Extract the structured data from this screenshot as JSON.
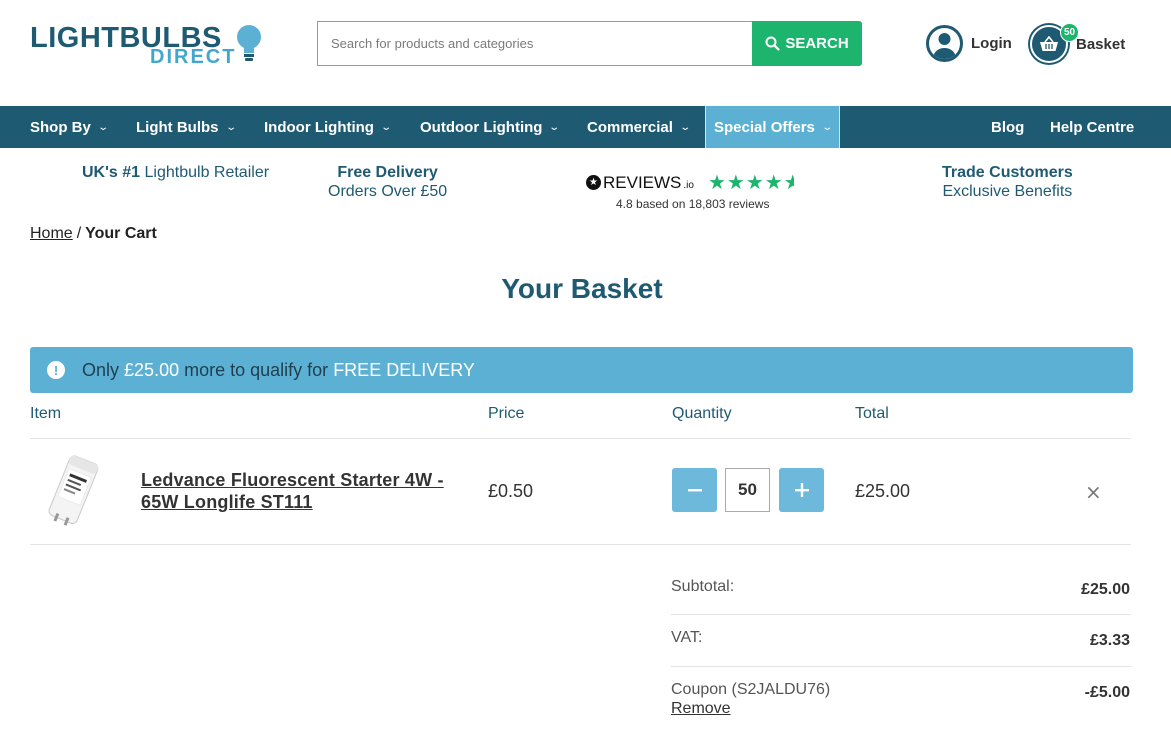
{
  "header": {
    "logo_top": "LIGHTBULBS",
    "logo_bottom": "DIRECT",
    "search_placeholder": "Search for products and categories",
    "search_button": "SEARCH",
    "login_label": "Login",
    "basket_label": "Basket",
    "basket_count": "50"
  },
  "nav": {
    "items": [
      {
        "label": "Shop By"
      },
      {
        "label": "Light Bulbs"
      },
      {
        "label": "Indoor Lighting"
      },
      {
        "label": "Outdoor Lighting"
      },
      {
        "label": "Commercial"
      },
      {
        "label": "Special Offers"
      }
    ],
    "blog": "Blog",
    "help": "Help Centre"
  },
  "usp": {
    "retailer_bold": "UK's #1",
    "retailer_rest": "Lightbulb Retailer",
    "delivery_line1": "Free Delivery",
    "delivery_line2": "Orders Over £50",
    "reviews_brand": "REVIEWS",
    "reviews_suffix": ".io",
    "reviews_rating": 4.8,
    "reviews_text": "4.8 based on 18,803 reviews",
    "trade_line1": "Trade Customers",
    "trade_line2": "Exclusive Benefits"
  },
  "breadcrumb": {
    "home": "Home",
    "separator": "/",
    "current": "Your Cart"
  },
  "page_title": "Your Basket",
  "banner": {
    "prefix": "Only",
    "amount": "£25.00",
    "middle": "more to qualify for",
    "highlight": "FREE DELIVERY"
  },
  "table": {
    "headers": {
      "item": "Item",
      "price": "Price",
      "quantity": "Quantity",
      "total": "Total"
    },
    "rows": [
      {
        "name": "Ledvance Fluorescent Starter 4W - 65W Longlife ST111",
        "price": "£0.50",
        "quantity": "50",
        "total": "£25.00"
      }
    ]
  },
  "summary": {
    "subtotal_label": "Subtotal:",
    "subtotal_value": "£25.00",
    "vat_label": "VAT:",
    "vat_value": "£3.33",
    "coupon_label": "Coupon (S2JALDU76)",
    "coupon_value": "-£5.00",
    "coupon_remove": "Remove"
  },
  "colors": {
    "brand_dark": "#1f5a73",
    "brand_light": "#5cb0d4",
    "accent_green": "#1db56d"
  },
  "icons": {
    "search": "search-icon",
    "login": "user-icon",
    "basket": "basket-icon",
    "chevron": "chevron-down-icon",
    "info": "info-icon",
    "remove": "close-icon",
    "minus": "minus-icon",
    "plus": "plus-icon"
  }
}
